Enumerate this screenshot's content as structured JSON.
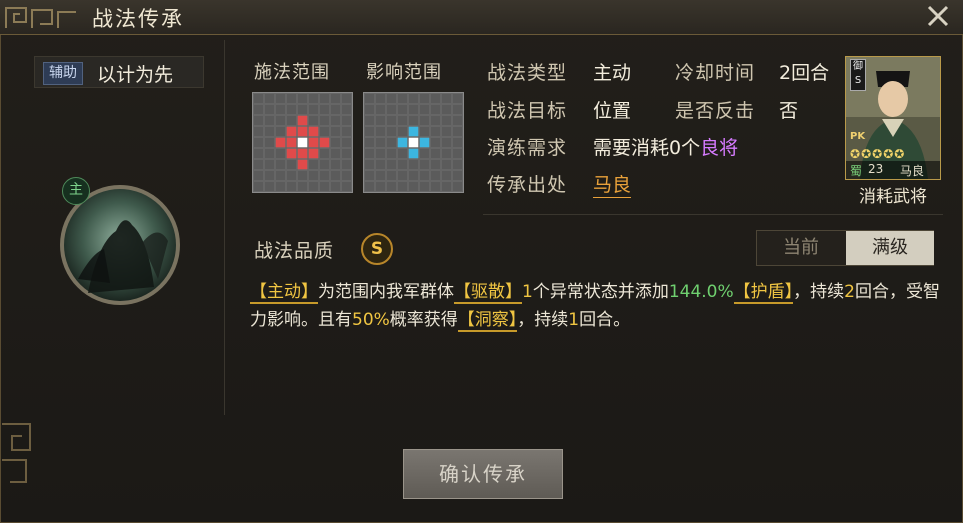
{
  "window": {
    "title": "战法传承"
  },
  "skill": {
    "tag": "辅助",
    "name": "以计为先",
    "badge": "主"
  },
  "range": {
    "cast_label": "施法范围",
    "effect_label": "影响范围",
    "cast_color": "#e04a4a",
    "effect_color": "#3cb6e0"
  },
  "info": {
    "type_label": "战法类型",
    "type_value": "主动",
    "cooldown_label": "冷却时间",
    "cooldown_value": "2回合",
    "target_label": "战法目标",
    "target_value": "位置",
    "counter_label": "是否反击",
    "counter_value": "否",
    "train_label": "演练需求",
    "train_prefix": "需要消耗0个",
    "train_highlight": "良将",
    "origin_label": "传承出处",
    "origin_value": "马良"
  },
  "general": {
    "faction": "蜀",
    "cost": "23",
    "name": "马良",
    "tag": "御S",
    "pk": "PK",
    "stars": 5,
    "caption": "消耗武将"
  },
  "quality": {
    "label": "战法品质",
    "grade": "S"
  },
  "level_tabs": {
    "current": "当前",
    "max": "满级",
    "selected": "max"
  },
  "description": {
    "p1": "【主动】",
    "p2": "为范围内我军群体",
    "p3": "【驱散】",
    "p4": "1",
    "p5": "个异常状态并添加",
    "p6": "144.0%",
    "p7": "【护盾】",
    "p8": "，持续",
    "p9": "2",
    "p10": "回合，受智力影响。且有",
    "p11": "50%",
    "p12": "概率获得",
    "p13": "【洞察】",
    "p14": "，持续",
    "p15": "1",
    "p16": "回合。"
  },
  "confirm_label": "确认传承"
}
